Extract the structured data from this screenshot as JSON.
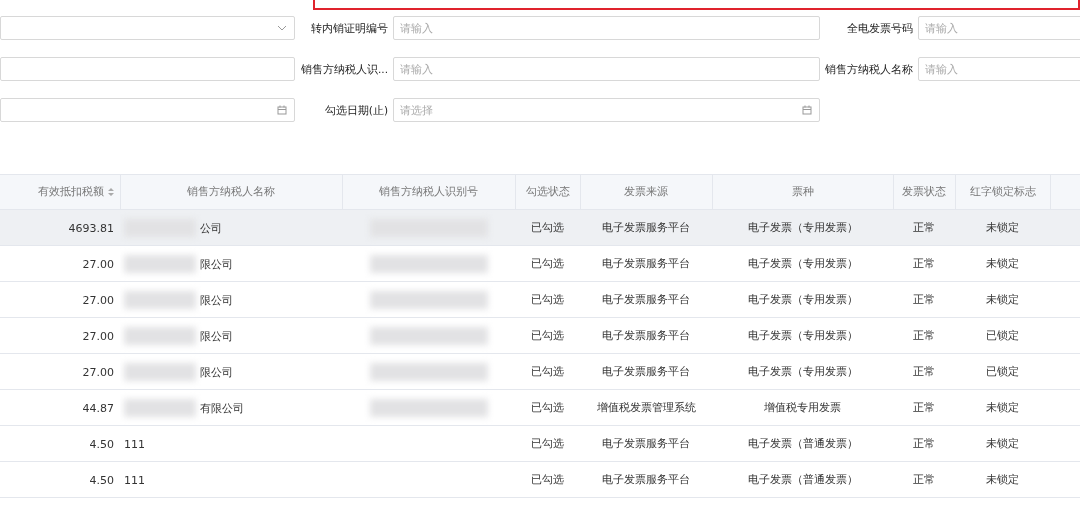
{
  "filters": [
    {
      "fields": [
        {
          "kind": "select"
        },
        {
          "kind": "input",
          "label": "转内销证明编号",
          "placeholder": "请输入"
        },
        {
          "kind": "input",
          "label": "全电发票号码",
          "placeholder": "请输入"
        }
      ]
    },
    {
      "fields": [
        {
          "kind": "input"
        },
        {
          "kind": "input",
          "label": "销售方纳税人识...",
          "placeholder": "请输入"
        },
        {
          "kind": "input",
          "label": "销售方纳税人名称",
          "placeholder": "请输入"
        }
      ]
    },
    {
      "fields": [
        {
          "kind": "date"
        },
        {
          "kind": "date",
          "label": "勾选日期(止)",
          "placeholder": "请选择"
        }
      ]
    }
  ],
  "table": {
    "columns": [
      {
        "label": "有效抵扣税额",
        "sortable": true
      },
      {
        "label": "销售方纳税人名称"
      },
      {
        "label": "销售方纳税人识别号"
      },
      {
        "label": "勾选状态"
      },
      {
        "label": "发票来源"
      },
      {
        "label": "票种"
      },
      {
        "label": "发票状态"
      },
      {
        "label": "红字锁定标志"
      },
      {}
    ],
    "rows": [
      {
        "selected": true,
        "redacted": true,
        "cells": [
          "4693.81",
          "公司",
          "",
          "已勾选",
          "电子发票服务平台",
          "电子发票（专用发票）",
          "正常",
          "未锁定"
        ]
      },
      {
        "selected": false,
        "redacted": true,
        "cells": [
          "27.00",
          "限公司",
          "",
          "已勾选",
          "电子发票服务平台",
          "电子发票（专用发票）",
          "正常",
          "未锁定"
        ]
      },
      {
        "selected": false,
        "redacted": true,
        "cells": [
          "27.00",
          "限公司",
          "",
          "已勾选",
          "电子发票服务平台",
          "电子发票（专用发票）",
          "正常",
          "未锁定"
        ]
      },
      {
        "selected": false,
        "redacted": true,
        "cells": [
          "27.00",
          "限公司",
          "",
          "已勾选",
          "电子发票服务平台",
          "电子发票（专用发票）",
          "正常",
          "已锁定"
        ]
      },
      {
        "selected": false,
        "redacted": true,
        "cells": [
          "27.00",
          "限公司",
          "",
          "已勾选",
          "电子发票服务平台",
          "电子发票（专用发票）",
          "正常",
          "已锁定"
        ]
      },
      {
        "selected": false,
        "redacted": true,
        "cells": [
          "44.87",
          "有限公司",
          "",
          "已勾选",
          "增值税发票管理系统",
          "增值税专用发票",
          "正常",
          "未锁定"
        ]
      },
      {
        "selected": false,
        "redacted": false,
        "cells": [
          "4.50",
          "111",
          "",
          "已勾选",
          "电子发票服务平台",
          "电子发票（普通发票）",
          "正常",
          "未锁定"
        ]
      },
      {
        "selected": false,
        "redacted": false,
        "cells": [
          "4.50",
          "111",
          "",
          "已勾选",
          "电子发票服务平台",
          "电子发票（普通发票）",
          "正常",
          "未锁定"
        ]
      }
    ]
  }
}
